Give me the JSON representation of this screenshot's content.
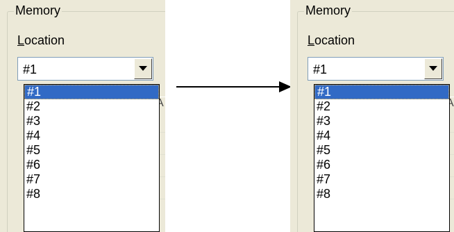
{
  "group_title": "Memory",
  "location_label": "Location",
  "location_accel": "L",
  "location_rest": "ocation",
  "combo_value": "#1",
  "items": [
    "#1",
    "#2",
    "#3",
    "#4",
    "#5",
    "#6",
    "#7",
    "#8"
  ],
  "selected_index": 0,
  "colors": {
    "selection": "#316ac5",
    "panel": "#ece9d8",
    "arrow": "#000000"
  },
  "icons": {
    "dropdown": "chevron-down-icon",
    "arrow": "arrow-right-icon"
  }
}
